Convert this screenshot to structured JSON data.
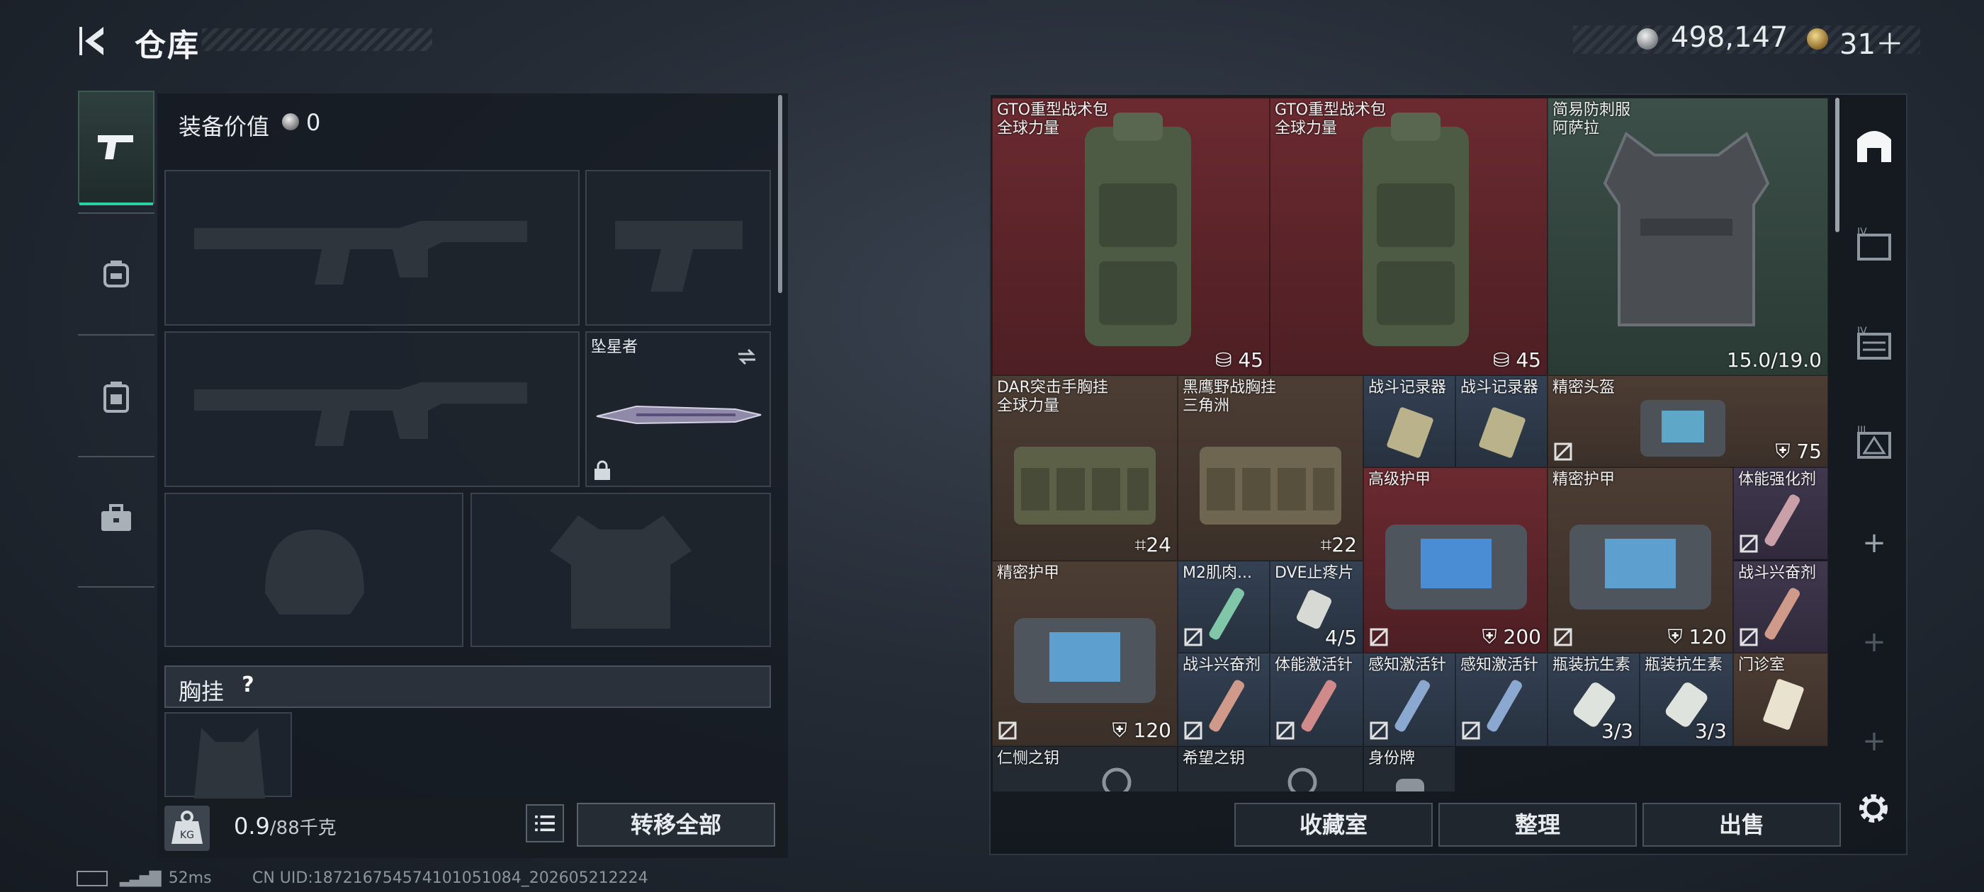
{
  "header": {
    "title": "仓库",
    "money": "498,147",
    "tokens": "31＋",
    "colors": {
      "accent": "#2bd0a0"
    }
  },
  "left_nav": {
    "items": [
      {
        "icon": "pistol-icon",
        "active": true
      },
      {
        "icon": "helmet-icon"
      },
      {
        "icon": "backpack-icon"
      },
      {
        "icon": "briefcase-icon"
      }
    ]
  },
  "loadout": {
    "value_label": "装备价值",
    "value": "0",
    "melee_name": "坠星者",
    "chest_title": "胸挂",
    "chest_help": "?",
    "weight": "0.9",
    "weight_unit": "/88千克",
    "transfer_label": "转移全部"
  },
  "stash": {
    "items": [
      {
        "name": "GTO重型战术包",
        "sub": "全球力量",
        "count": "45",
        "tier": "red"
      },
      {
        "name": "GTO重型战术包",
        "sub": "全球力量",
        "count": "45",
        "tier": "red"
      },
      {
        "name": "简易防刺服",
        "sub": "阿萨拉",
        "count": "15.0/19.0",
        "tier": "green"
      },
      {
        "name": "DAR突击手胸挂",
        "sub": "全球力量",
        "count": "24",
        "tier": "brown"
      },
      {
        "name": "黑鹰野战胸挂",
        "sub": "三角洲",
        "count": "22",
        "tier": "brown"
      },
      {
        "name": "战斗记录器",
        "tier": "blue"
      },
      {
        "name": "战斗记录器",
        "tier": "blue"
      },
      {
        "name": "精密头盔",
        "count": "75",
        "tier": "brown"
      },
      {
        "name": "高级护甲",
        "count": "200",
        "tier": "red"
      },
      {
        "name": "精密护甲",
        "count": "120",
        "tier": "brown"
      },
      {
        "name": "体能强化剂",
        "tier": "purple"
      },
      {
        "name": "精密护甲",
        "count": "120",
        "tier": "brown"
      },
      {
        "name": "M2肌肉...",
        "tier": "blue"
      },
      {
        "name": "DVE止疼片",
        "count": "4/5",
        "tier": "blue"
      },
      {
        "name": "战斗兴奋剂",
        "tier": "blue"
      },
      {
        "name": "战斗兴奋剂",
        "tier": "blue"
      },
      {
        "name": "体能激活针",
        "tier": "blue"
      },
      {
        "name": "感知激活针",
        "tier": "blue"
      },
      {
        "name": "感知激活针",
        "tier": "blue"
      },
      {
        "name": "瓶装抗生素",
        "count": "3/3",
        "tier": "blue"
      },
      {
        "name": "瓶装抗生素",
        "count": "3/3",
        "tier": "blue"
      },
      {
        "name": "门诊室",
        "tier": "brown"
      },
      {
        "name": "仁恻之钥",
        "tier": "grey"
      },
      {
        "name": "希望之钥",
        "tier": "grey"
      },
      {
        "name": "身份牌",
        "tier": "grey"
      }
    ]
  },
  "bottom": {
    "collection": "收藏室",
    "sort": "整理",
    "sell": "出售"
  },
  "status": {
    "ping": "52ms",
    "uid": "CN UID:18721675457410105108​4_202605212224"
  }
}
